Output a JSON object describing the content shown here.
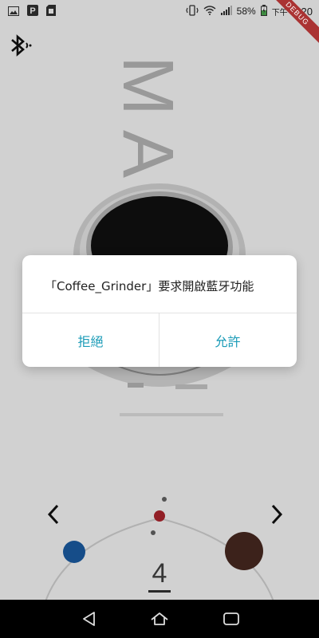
{
  "status_bar": {
    "battery_percent": "58%",
    "time": "5:20",
    "ampm": "下午",
    "icons": [
      "image-icon",
      "p-app-icon",
      "sd-card-icon",
      "vibrate-icon",
      "wifi-icon",
      "signal-icon",
      "battery-charging-icon"
    ]
  },
  "app": {
    "brand_text": "MA",
    "grind_setting": "4",
    "dial_colors": {
      "left_dot": "#1b5fa8",
      "center_dot": "#b3262f",
      "right_dot": "#4a2a22"
    },
    "icons": {
      "bluetooth": "bluetooth-icon",
      "prev": "chevron-left-icon",
      "next": "chevron-right-icon"
    }
  },
  "debug_banner": "DEBUG",
  "dialog": {
    "message": "「Coffee_Grinder」要求開啟藍牙功能",
    "deny_label": "拒絕",
    "allow_label": "允許",
    "accent_color": "#1a9bb7"
  },
  "nav_bar": {
    "icons": [
      "back-icon",
      "home-icon",
      "recents-icon"
    ]
  }
}
